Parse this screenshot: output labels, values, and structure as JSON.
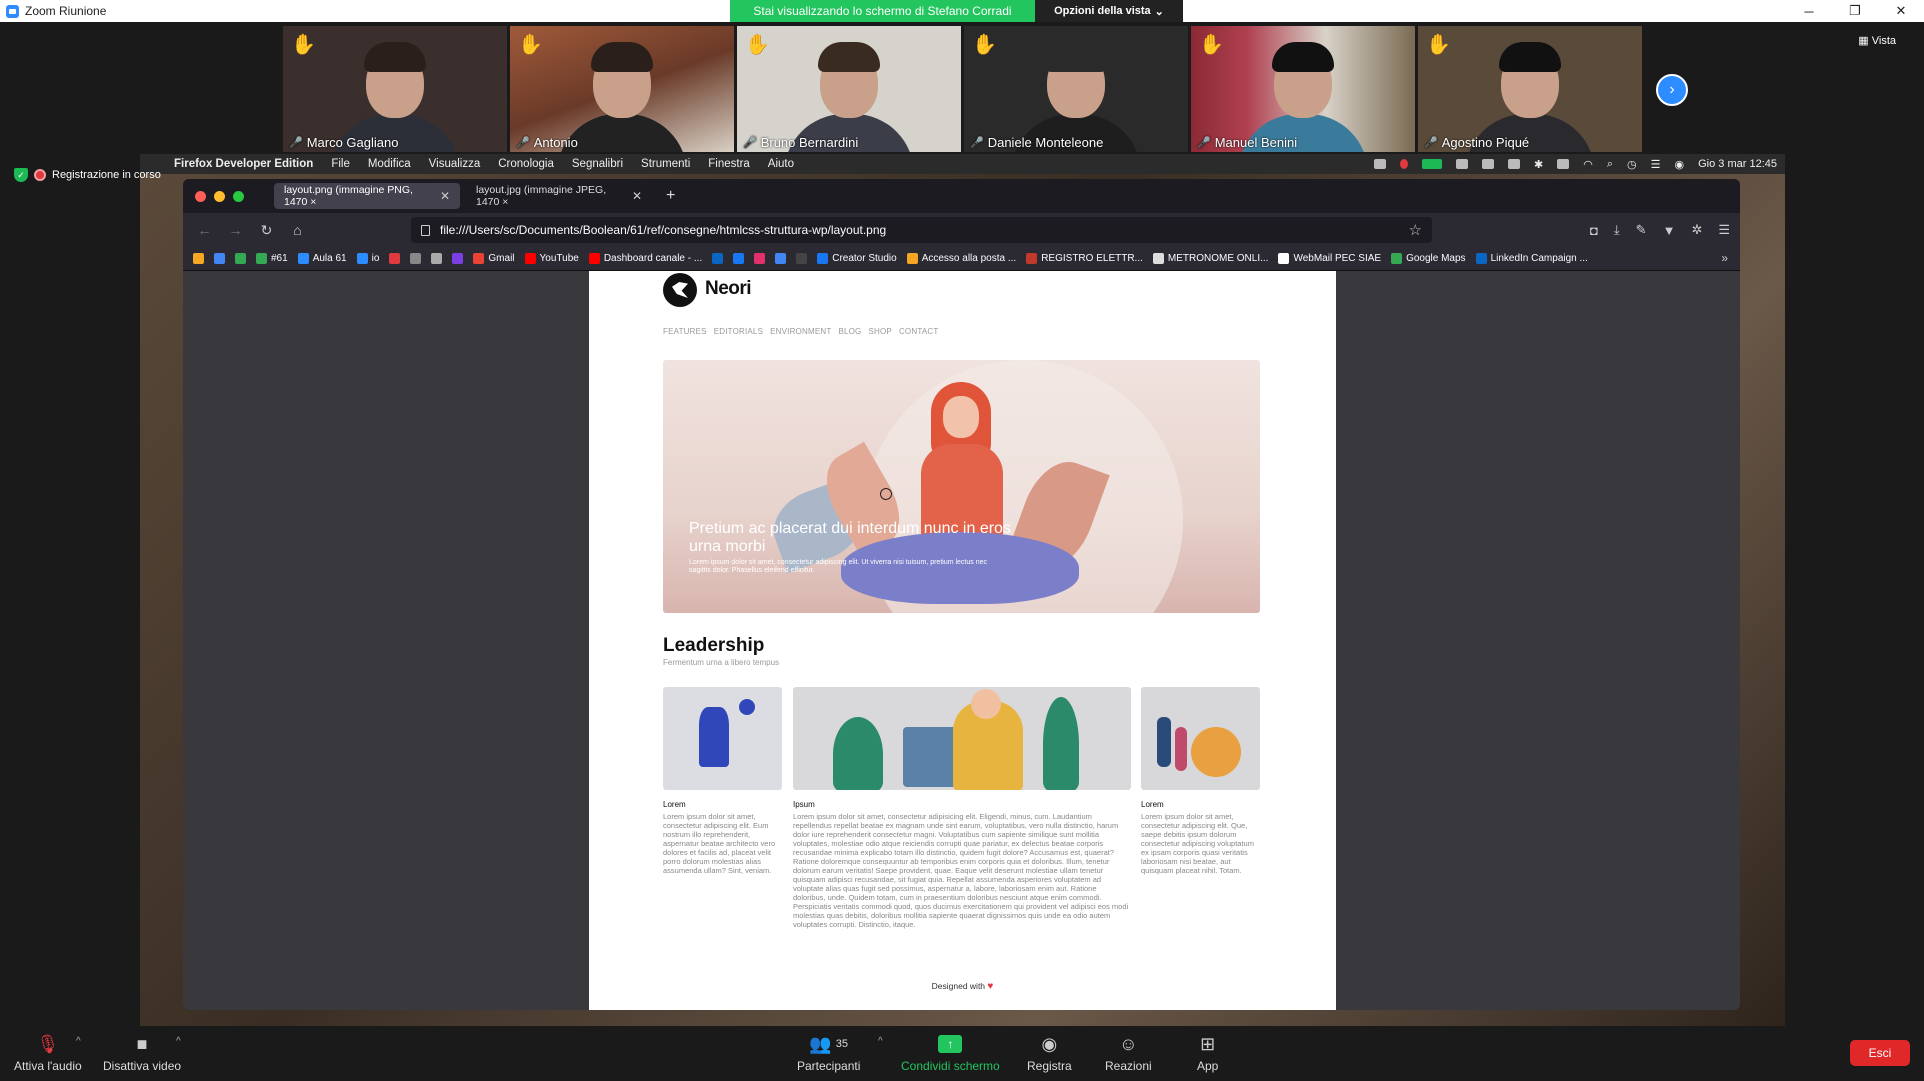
{
  "zoom": {
    "window_title": "Zoom Riunione",
    "share_banner": "Stai visualizzando lo schermo di Stefano Corradi",
    "view_options": "Opzioni della vista",
    "view_button": "Vista",
    "recording_status": "Registrazione in corso"
  },
  "participants": [
    {
      "name": "Marco Gagliano"
    },
    {
      "name": "Antonio"
    },
    {
      "name": "Bruno Bernardini"
    },
    {
      "name": "Daniele Monteleone"
    },
    {
      "name": "Manuel Benini"
    },
    {
      "name": "Agostino Piqué"
    }
  ],
  "mac_menu": {
    "app_name": "Firefox Developer Edition",
    "items": [
      "File",
      "Modifica",
      "Visualizza",
      "Cronologia",
      "Segnalibri",
      "Strumenti",
      "Finestra",
      "Aiuto"
    ],
    "clock": "Gio 3 mar  12:45"
  },
  "firefox": {
    "tabs": [
      {
        "label": "layout.png (immagine PNG, 1470 ×"
      },
      {
        "label": "layout.jpg (immagine JPEG, 1470 ×"
      }
    ],
    "url": "file:///Users/sc/Documents/Boolean/61/ref/consegne/htmlcss-struttura-wp/layout.png",
    "bookmarks": [
      {
        "label": "",
        "color": "#f5a623"
      },
      {
        "label": "",
        "color": "#4285f4"
      },
      {
        "label": "",
        "color": "#34a853"
      },
      {
        "label": "#61",
        "color": "#34a853"
      },
      {
        "label": "Aula 61",
        "color": "#2d8cff"
      },
      {
        "label": "io",
        "color": "#2d8cff"
      },
      {
        "label": "",
        "color": "#e0393e"
      },
      {
        "label": "",
        "color": "#888888"
      },
      {
        "label": "",
        "color": "#aaaaaa"
      },
      {
        "label": "",
        "color": "#7b3fe4"
      },
      {
        "label": "Gmail",
        "color": "#ea4335"
      },
      {
        "label": "YouTube",
        "color": "#ff0000"
      },
      {
        "label": "Dashboard canale - ...",
        "color": "#ff0000"
      },
      {
        "label": "",
        "color": "#0a66c2"
      },
      {
        "label": "",
        "color": "#1877f2"
      },
      {
        "label": "",
        "color": "#e1306c"
      },
      {
        "label": "",
        "color": "#4285f4"
      },
      {
        "label": "",
        "color": "#444444"
      },
      {
        "label": "Creator Studio",
        "color": "#1877f2"
      },
      {
        "label": "Accesso alla posta ...",
        "color": "#f5a623"
      },
      {
        "label": "REGISTRO ELETTR...",
        "color": "#c0392b"
      },
      {
        "label": "METRONOME ONLI...",
        "color": "#dddddd"
      },
      {
        "label": "WebMail PEC SIAE",
        "color": "#ffffff"
      },
      {
        "label": "Google Maps",
        "color": "#34a853"
      },
      {
        "label": "LinkedIn Campaign ...",
        "color": "#0a66c2"
      }
    ]
  },
  "page": {
    "brand": "Neori",
    "nav": [
      "FEATURES",
      "EDITORIALS",
      "ENVIRONMENT",
      "BLOG",
      "SHOP",
      "CONTACT"
    ],
    "hero_title": "Pretium ac placerat dui interdum nunc in eros urna morbi",
    "hero_text": "Lorem ipsum dolor sit amet, consectetur adipiscing elit. Ut viverra nisi tuisum, pretium lectus nec sagittis dolor. Phasellus eleifend efficitur.",
    "leadership_title": "Leadership",
    "leadership_sub": "Fermentum urna a libero tempus",
    "cards": [
      {
        "label": "Lorem",
        "text": "Lorem ipsum dolor sit amet, consectetur adipiscing elit. Eum nostrum illo reprehenderit, aspernatur beatae architecto vero dolores et facilis ad, placeat velit porro dolorum molestias alias assumenda ullam? Sint, veniam."
      },
      {
        "label": "Ipsum",
        "text": "Lorem ipsum dolor sit amet, consectetur adipisicing elit. Eligendi, minus, cum. Laudantium repellendus repellat beatae ex magnam unde sint earum, voluptatibus, vero nulla distinctio, harum dolor iure reprehenderit consectetur magni. Voluptatibus cum sapiente similique sunt mollitia voluptates, molestiae odio atque reiciendis corrupti quae pariatur, ex delectus beatae corporis recusandae minima explicabo totam illo distinctio, quidem fugit dolore? Accusamus est, quaerat? Ratione doloremque consequuntur ab temporibus enim corporis quia et doloribus. Illum, tenetur dolorum earum veritatis! Saepe provident, quae. Eaque velit deserunt molestiae ullam tenetur quisquam adipisci recusandae, sit fugiat quia. Repellat assumenda asperiores voluptatem ad voluptate alias quas fugit sed possimus, aspernatur a, labore, laboriosam enim aut. Ratione doloribus, unde. Quidem totam, cum in praesentium doloribus nesciunt atque enim commodi. Perspiciatis veritatis commodi quod, quos ducimus exercitationem qui provident vel adipisci eos modi molestias quas debitis, doloribus mollitia sapiente quaerat dignissimos quis unde ea odio autem voluptates corrupti. Distinctio, itaque."
      },
      {
        "label": "Lorem",
        "text": "Lorem ipsum dolor sit amet, consectetur adipiscing elit. Que, saepe debitis ipsum dolorum consectetur adipiscing voluptatum ex ipsam corporis quasi veritatis laboriosam nisi beatae, aut quisquam placeat nihil. Totam."
      }
    ],
    "footer": "Designed with",
    "footer_heart": "♥"
  },
  "toolbar": {
    "audio": "Attiva l'audio",
    "video": "Disattiva video",
    "participants": "Partecipanti",
    "participants_count": "35",
    "share": "Condividi schermo",
    "record": "Registra",
    "reactions": "Reazioni",
    "apps": "App",
    "leave": "Esci"
  }
}
